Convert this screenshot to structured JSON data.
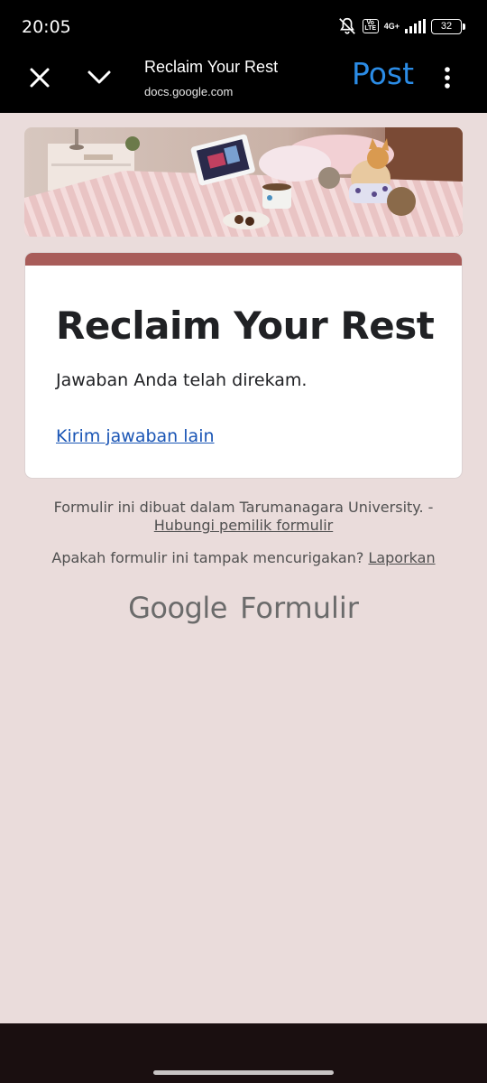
{
  "status_bar": {
    "time": "20:05",
    "network_label": "4G+",
    "volte_label": "Vo LTE",
    "battery": "32"
  },
  "toolbar": {
    "title": "Reclaim Your Rest",
    "url": "docs.google.com",
    "post_label": "Post",
    "accent_color": "#2b8ce6"
  },
  "form": {
    "title": "Reclaim Your Rest",
    "message": "Jawaban Anda telah direkam.",
    "resubmit_link": "Kirim jawaban lain",
    "accent_color": "#a85c59"
  },
  "footer": {
    "created_in": "Formulir ini dibuat dalam Tarumanagara University. -",
    "contact_owner": "Hubungi pemilik formulir",
    "suspicious_prompt": "Apakah formulir ini tampak mencurigakan?",
    "report_link": "Laporkan",
    "brand_google": "Google",
    "brand_product": "Formulir"
  },
  "icons": {
    "close": "close-icon",
    "chevron": "chevron-down-icon",
    "more": "more-vert-icon",
    "bell_off": "bell-off-icon",
    "signal": "signal-icon",
    "battery": "battery-icon"
  }
}
